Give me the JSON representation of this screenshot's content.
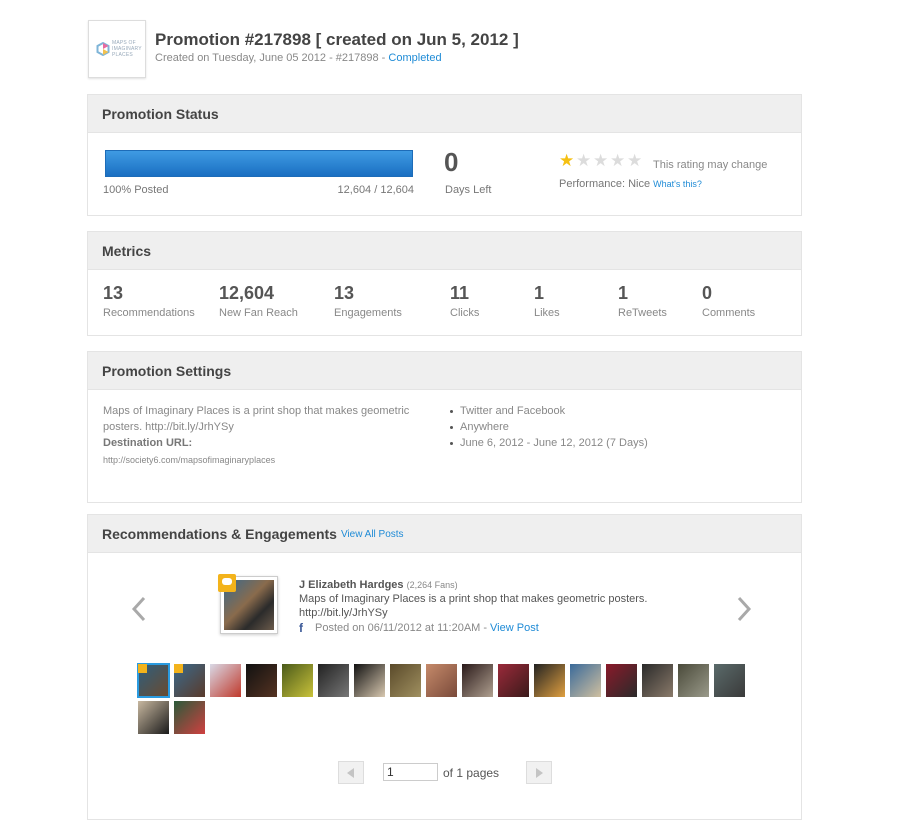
{
  "header": {
    "logo_text": "MAPS OF IMAGINARY PLACES",
    "title": "Promotion #217898 [ created on Jun 5, 2012 ]",
    "subtitle_prefix": "Created on Tuesday, June 05 2012 - #217898 - ",
    "status_link": "Completed"
  },
  "status": {
    "heading": "Promotion Status",
    "progress": 1.0,
    "posted_label": "100% Posted",
    "posted_count": "12,604 / 12,604",
    "days_left": "0",
    "days_left_label": "Days Left",
    "rating": 1,
    "rating_max": 5,
    "rating_note": "This rating may change",
    "performance": "Performance: Nice",
    "whats_this": "What's this?"
  },
  "metrics": {
    "heading": "Metrics",
    "items": [
      {
        "value": "13",
        "label": "Recommendations"
      },
      {
        "value": "12,604",
        "label": "New Fan Reach"
      },
      {
        "value": "13",
        "label": "Engagements"
      },
      {
        "value": "11",
        "label": "Clicks"
      },
      {
        "value": "1",
        "label": "Likes"
      },
      {
        "value": "1",
        "label": "ReTweets"
      },
      {
        "value": "0",
        "label": "Comments"
      }
    ]
  },
  "settings": {
    "heading": "Promotion Settings",
    "description": "Maps of Imaginary Places is a print shop that makes geometric posters. http://bit.ly/JrhYSy",
    "destination_label": "Destination URL:",
    "destination_url": "http://society6.com/mapsofimaginaryplaces",
    "list": [
      "Twitter and Facebook",
      "Anywhere",
      "June 6, 2012 - June 12, 2012 (7 Days)"
    ]
  },
  "recs": {
    "heading": "Recommendations & Engagements",
    "view_all": "View All Posts",
    "prev_icon": "chevron-left-icon",
    "next_icon": "chevron-right-icon",
    "post": {
      "author": "J Elizabeth Hardges",
      "fans": "(2,264 Fans)",
      "text": "Maps of Imaginary Places is a print shop that makes geometric posters. http://bit.ly/JrhYSy",
      "network_icon": "facebook-icon",
      "posted": "Posted on 06/11/2012 at 11:20AM - ",
      "view_post": "View Post"
    },
    "thumbnails": [
      {
        "colors": [
          "#2d5f7f",
          "#6b4a2e"
        ],
        "selected": true,
        "badge": true
      },
      {
        "colors": [
          "#3a6a8c",
          "#5a3a2a"
        ],
        "selected": false,
        "badge": true
      },
      {
        "colors": [
          "#d9d9e6",
          "#c0392b"
        ],
        "selected": false,
        "badge": false
      },
      {
        "colors": [
          "#111111",
          "#553322"
        ],
        "selected": false,
        "badge": false
      },
      {
        "colors": [
          "#4a5a1a",
          "#c9c23a"
        ],
        "selected": false,
        "badge": false
      },
      {
        "colors": [
          "#222222",
          "#777777"
        ],
        "selected": false,
        "badge": false
      },
      {
        "colors": [
          "#111111",
          "#d8c8b0"
        ],
        "selected": false,
        "badge": false
      },
      {
        "colors": [
          "#5a4a2a",
          "#a09060"
        ],
        "selected": false,
        "badge": false
      },
      {
        "colors": [
          "#c58a6a",
          "#7a4a3a"
        ],
        "selected": false,
        "badge": false
      },
      {
        "colors": [
          "#2a1a1a",
          "#b0a090"
        ],
        "selected": false,
        "badge": false
      },
      {
        "colors": [
          "#9a2a3a",
          "#3a1a1a"
        ],
        "selected": false,
        "badge": false
      },
      {
        "colors": [
          "#222222",
          "#e0a040"
        ],
        "selected": false,
        "badge": false
      },
      {
        "colors": [
          "#3a6a9a",
          "#d0c0a0"
        ],
        "selected": false,
        "badge": false
      },
      {
        "colors": [
          "#8a1a2a",
          "#2a2a2a"
        ],
        "selected": false,
        "badge": false
      },
      {
        "colors": [
          "#2a2a2a",
          "#8a7a6a"
        ],
        "selected": false,
        "badge": false
      },
      {
        "colors": [
          "#4a4a3a",
          "#9a9a8a"
        ],
        "selected": false,
        "badge": false
      },
      {
        "colors": [
          "#5a6a6a",
          "#3a3a3a"
        ],
        "selected": false,
        "badge": false
      },
      {
        "colors": [
          "#c8b8a0",
          "#1a1a1a"
        ],
        "selected": false,
        "badge": false
      },
      {
        "colors": [
          "#2a5a3a",
          "#d04040"
        ],
        "selected": false,
        "badge": false
      }
    ]
  },
  "pager": {
    "page": "1",
    "of_label": "of 1 pages"
  },
  "colors": {
    "accent": "#1f8bd6",
    "progress": "#2a86d6",
    "star": "#f5c012"
  }
}
